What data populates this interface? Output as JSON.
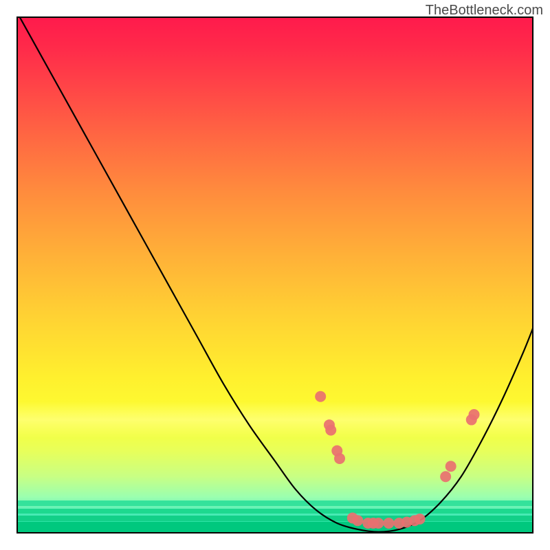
{
  "watermark": "TheBottleneck.com",
  "chart_data": {
    "type": "line",
    "title": "",
    "xlabel": "",
    "ylabel": "",
    "xlim": [
      0,
      100
    ],
    "ylim": [
      0,
      100
    ],
    "grid": false,
    "series": [
      {
        "name": "bottleneck-curve",
        "x": [
          0,
          5,
          10,
          15,
          20,
          25,
          30,
          35,
          40,
          45,
          50,
          54,
          58,
          62,
          66,
          70,
          74,
          78,
          82,
          86,
          90,
          94,
          98,
          100
        ],
        "y": [
          101,
          92,
          83,
          74,
          65,
          56,
          47,
          38,
          29,
          21,
          14,
          8.5,
          4.5,
          2,
          0.8,
          0.3,
          0.8,
          2.5,
          6,
          11,
          18,
          26,
          35,
          40
        ]
      }
    ],
    "markers": [
      {
        "x": 58.8,
        "y": 26.5
      },
      {
        "x": 60.5,
        "y": 21
      },
      {
        "x": 60.8,
        "y": 20
      },
      {
        "x": 62,
        "y": 16
      },
      {
        "x": 62.5,
        "y": 14.5
      },
      {
        "x": 65,
        "y": 3
      },
      {
        "x": 66,
        "y": 2.5
      },
      {
        "x": 68,
        "y": 2
      },
      {
        "x": 69,
        "y": 2
      },
      {
        "x": 70,
        "y": 2
      },
      {
        "x": 72,
        "y": 2
      },
      {
        "x": 74,
        "y": 2
      },
      {
        "x": 75.5,
        "y": 2.2
      },
      {
        "x": 77,
        "y": 2.5
      },
      {
        "x": 78,
        "y": 2.8
      },
      {
        "x": 83,
        "y": 11
      },
      {
        "x": 84,
        "y": 13
      },
      {
        "x": 88,
        "y": 22
      },
      {
        "x": 88.5,
        "y": 23
      }
    ],
    "marker_color": "#e97070",
    "curve_color": "#000000",
    "background": "bottleneck-gradient"
  }
}
